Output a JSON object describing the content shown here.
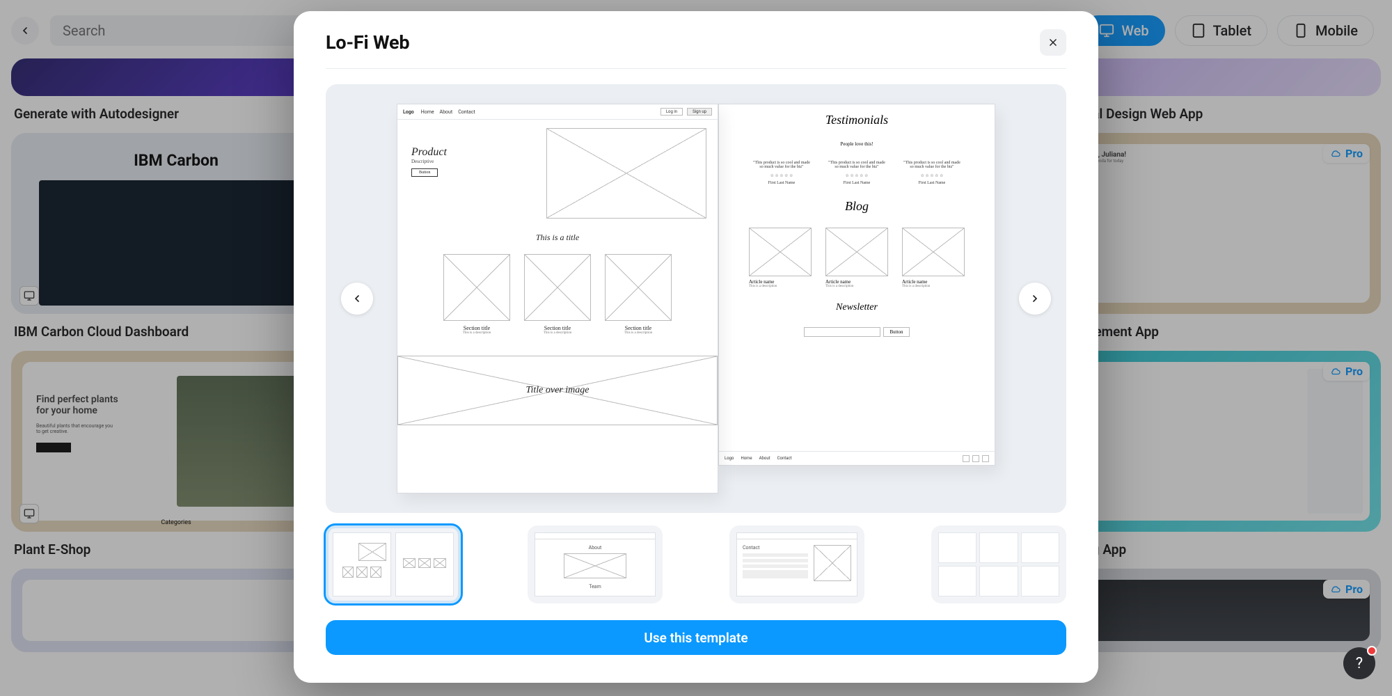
{
  "toolbar": {
    "search_placeholder": "Search",
    "tabs": {
      "web": "Web",
      "tablet": "Tablet",
      "mobile": "Mobile"
    }
  },
  "bg_cards": {
    "c1_title": "Generate with Autodesigner",
    "c2_title": "Material Design Web App",
    "c3_title": "IBM Carbon Cloud Dashboard",
    "c4_title": "Management App",
    "c5_title": "Plant E-Shop",
    "c6_title": "Sharing App",
    "pro_label": "Pro",
    "ibm_header": "IBM Carbon",
    "plant_h1": "Find perfect plants",
    "plant_h2": "for your home",
    "plant_sub": "Beautiful plants that encourage you to get creative.",
    "plant_cat": "Categories",
    "mgmt_hello": "Welcome, Juliana!",
    "mgmt_sub": "Here is your agenda for today"
  },
  "modal": {
    "title": "Lo-Fi Web",
    "primary_button": "Use this template",
    "wireframe_a": {
      "logo": "Logo",
      "nav": [
        "Home",
        "About",
        "Contact"
      ],
      "btn_login": "Log in",
      "btn_signup": "Sign up",
      "product": "Product",
      "descriptive": "Descriptive",
      "btn_generic": "Button",
      "title_row": "This is a title",
      "section": "Section title",
      "section_sub": "This is a description",
      "over_image": "Title over image"
    },
    "wireframe_b": {
      "testimonials": "Testimonials",
      "sub": "People love this!",
      "quote": "\"This product is so cool and made so much value for the biz\"",
      "person": "First Last Name",
      "blog": "Blog",
      "article": "Article name",
      "article_sub": "This is a description",
      "newsletter": "Newsletter",
      "btn_sub": "Button",
      "foot_nav": [
        "Home",
        "About",
        "Contact"
      ]
    },
    "thumb_b": {
      "about": "About",
      "team": "Team"
    },
    "thumb_c": {
      "contact": "Contact"
    }
  }
}
